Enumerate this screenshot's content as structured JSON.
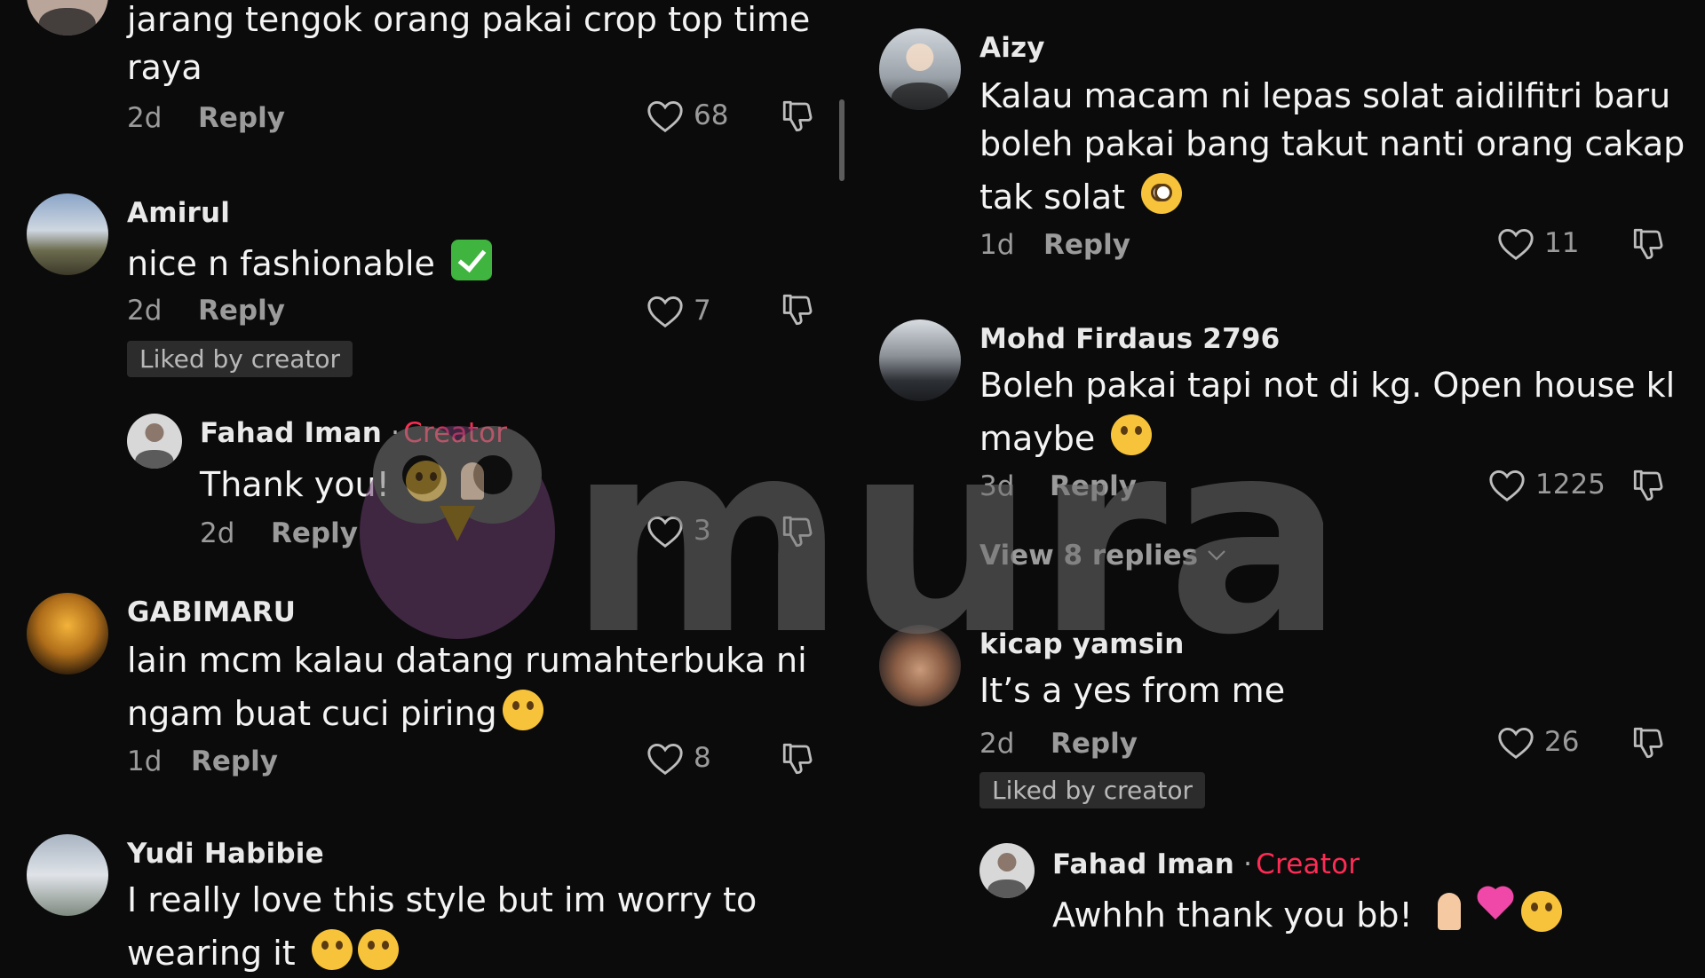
{
  "left_comments": [
    {
      "username": "",
      "text_lines": [
        "jarang tengok orang pakai crop top time",
        "raya"
      ],
      "age": "2d",
      "reply": "Reply",
      "likes": "68",
      "liked_by_creator": ""
    },
    {
      "username": "Amirul",
      "text_lines": [
        "nice n fashionable"
      ],
      "emoji": "check-mark",
      "age": "2d",
      "reply": "Reply",
      "likes": "7",
      "liked_by_creator": "Liked by creator"
    },
    {
      "username": "Fahad Iman",
      "creator_label": "Creator",
      "text_lines": [
        "Thank you!"
      ],
      "emoji": "grin-pray",
      "age": "2d",
      "reply": "Reply",
      "likes": "3"
    },
    {
      "username": "GABIMARU",
      "text_lines": [
        "lain mcm kalau datang rumahterbuka ni",
        "ngam buat cuci piring"
      ],
      "emoji": "tears-of-joy",
      "age": "1d",
      "reply": "Reply",
      "likes": "8"
    },
    {
      "username": "Yudi Habibie",
      "text_lines": [
        "I really love this style but im worry to",
        "wearing it"
      ],
      "emoji": "tears-of-joy-pleading"
    }
  ],
  "right_comments": [
    {
      "username": "Aizy",
      "text_lines": [
        "Kalau macam ni lepas solat aidilfitri baru",
        "boleh pakai bang takut nanti orang cakap",
        "tak solat"
      ],
      "emoji": "flushed",
      "age": "1d",
      "reply": "Reply",
      "likes": "11"
    },
    {
      "username": "Mohd Firdaus 2796",
      "text_lines": [
        "Boleh pakai tapi not di kg. Open house kl",
        "maybe"
      ],
      "emoji": "tears-of-joy",
      "age": "3d",
      "reply": "Reply",
      "likes": "1225",
      "view_replies": "View 8 replies"
    },
    {
      "username": "kicap yamsin",
      "text_lines": [
        "It’s a yes from me"
      ],
      "age": "2d",
      "reply": "Reply",
      "likes": "26",
      "liked_by_creator": "Liked by creator"
    },
    {
      "username": "Fahad Iman",
      "creator_label": "Creator",
      "text_lines": [
        "Awhhh thank you bb!"
      ],
      "emoji": "pray-sparkling-heart-smiling-hearts"
    }
  ],
  "watermark": "murai",
  "colors": {
    "background": "#0b0b0b",
    "creator": "#fe2c55",
    "muted": "#9b9b9b"
  }
}
